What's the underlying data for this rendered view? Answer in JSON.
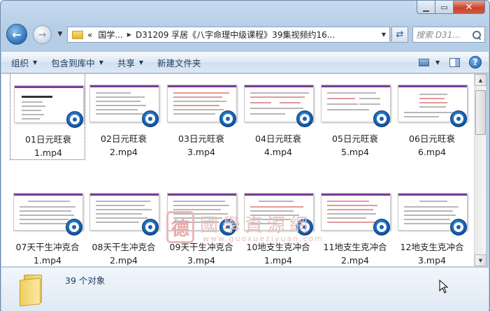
{
  "window": {
    "caption_buttons": {
      "minimize_icon": "minimize-icon",
      "maximize_icon": "maximize-icon",
      "close_icon": "close-icon"
    }
  },
  "nav": {
    "breadcrumb": {
      "overflow": "«",
      "segments": [
        "国学...",
        "D31209 孚居《八字命理中级课程》39集视频约16..."
      ]
    },
    "search_placeholder": "搜索 D31..."
  },
  "toolbar": {
    "organize": "组织",
    "include_in_library": "包含到库中",
    "share": "共享",
    "new_folder": "新建文件夹"
  },
  "files": [
    {
      "line1": "01日元旺衰",
      "line2": "1.mp4"
    },
    {
      "line1": "02日元旺衰",
      "line2": "2.mp4"
    },
    {
      "line1": "03日元旺衰",
      "line2": "3.mp4"
    },
    {
      "line1": "04日元旺衰",
      "line2": "4.mp4"
    },
    {
      "line1": "05日元旺衰",
      "line2": "5.mp4"
    },
    {
      "line1": "06日元旺衰",
      "line2": "6.mp4"
    },
    {
      "line1": "07天干生冲克合",
      "line2": "1.mp4"
    },
    {
      "line1": "08天干生冲克合",
      "line2": "2.mp4"
    },
    {
      "line1": "09天干生冲克合",
      "line2": "3.mp4"
    },
    {
      "line1": "10地支生克冲合",
      "line2": "1.mp4"
    },
    {
      "line1": "11地支生克冲合",
      "line2": "2.mp4"
    },
    {
      "line1": "12地支生克冲合",
      "line2": "3.mp4"
    }
  ],
  "watermark": {
    "seal": "德",
    "text": "國學資源網",
    "url": "www.guoxueziyuan.com"
  },
  "details": {
    "count_text": "39 个对象"
  }
}
